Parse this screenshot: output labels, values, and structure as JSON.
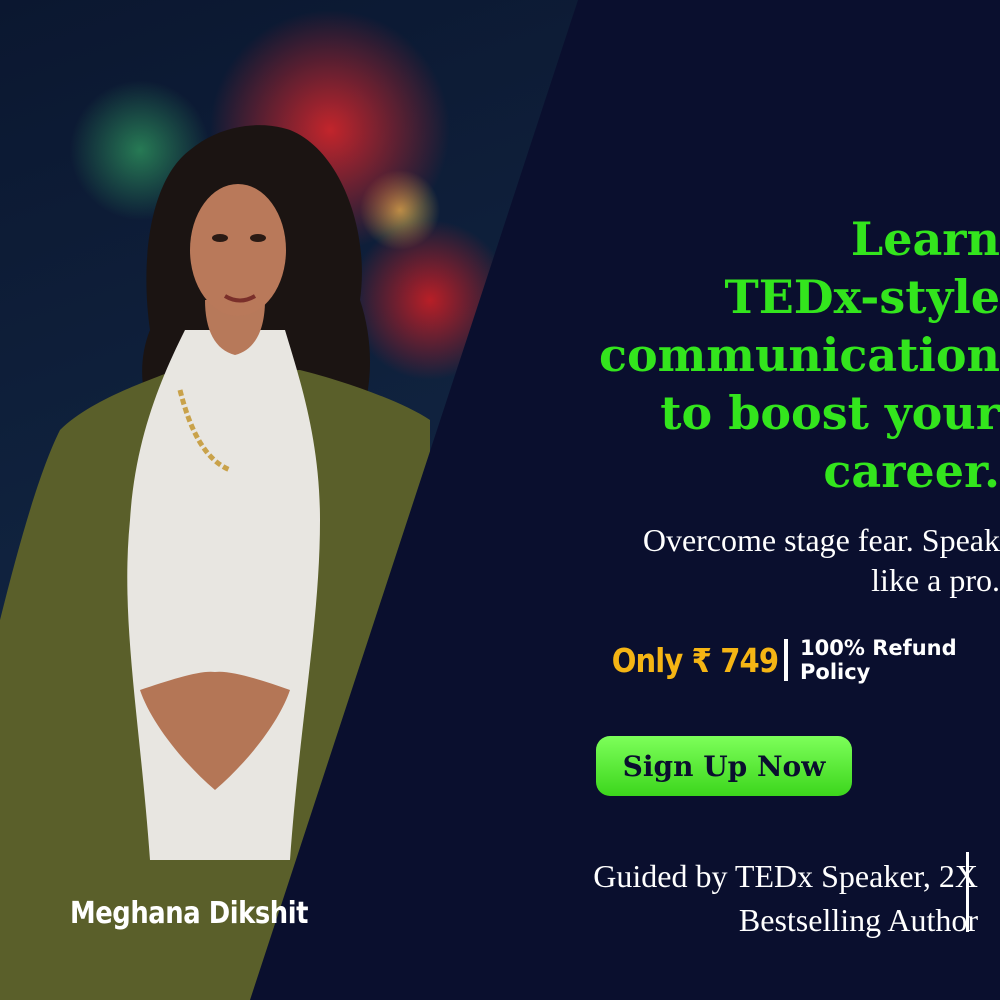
{
  "headline": {
    "lines": [
      "Learn",
      "TEDx-style",
      "communication",
      "to boost your",
      "career."
    ]
  },
  "subhead": {
    "lines": [
      "Overcome stage fear. Speak",
      "like a pro."
    ]
  },
  "offer": {
    "price": "Only ₹ 749",
    "refund_lines": [
      "100% Refund",
      "Policy"
    ]
  },
  "cta": {
    "label": "Sign Up Now"
  },
  "credentials": {
    "lines": [
      "Guided by TEDx Speaker, 2X",
      "Bestselling Author"
    ]
  },
  "speaker": {
    "name": "Meghana Dikshit"
  },
  "colors": {
    "background": "#0a0f2e",
    "headline": "#33e51d",
    "price": "#f5b514",
    "cta": "#5ff03a"
  }
}
